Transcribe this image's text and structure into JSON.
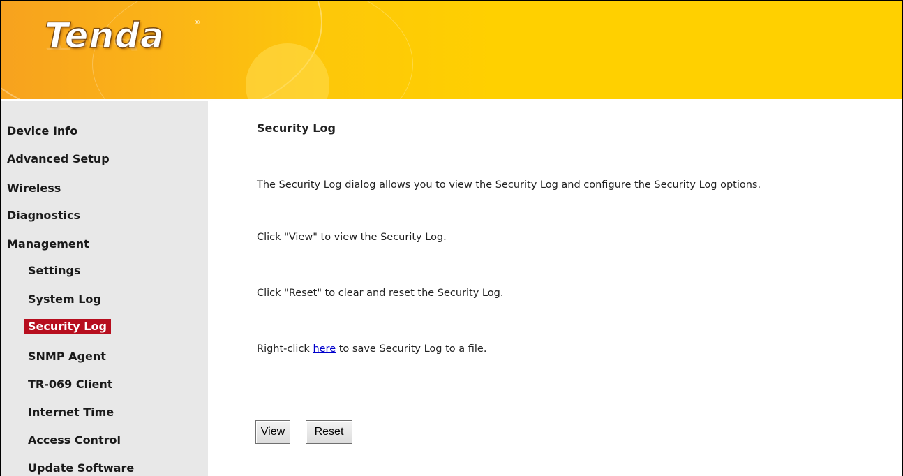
{
  "brand": {
    "logo_text": "Tenda",
    "trademark": "®"
  },
  "sidebar": {
    "items": [
      {
        "label": "Device Info"
      },
      {
        "label": "Advanced Setup"
      },
      {
        "label": "Wireless"
      },
      {
        "label": "Diagnostics"
      },
      {
        "label": "Management"
      },
      {
        "label": "Settings"
      },
      {
        "label": "System Log"
      },
      {
        "label": "Security Log"
      },
      {
        "label": "SNMP Agent"
      },
      {
        "label": "TR-069 Client"
      },
      {
        "label": "Internet Time"
      },
      {
        "label": "Access Control"
      },
      {
        "label": "Update Software"
      }
    ],
    "active_item": "Security Log"
  },
  "main": {
    "title": "Security Log",
    "description": "The Security Log dialog allows you to view the Security Log and configure the Security Log options.",
    "view_hint": "Click \"View\" to view the Security Log.",
    "reset_hint": "Click \"Reset\" to clear and reset the Security Log.",
    "save_hint_prefix": "Right-click ",
    "save_hint_link": "here",
    "save_hint_suffix": " to save Security Log to a file.",
    "view_button": "View",
    "reset_button": "Reset"
  },
  "colors": {
    "header_yellow": "#ffd000",
    "sidebar_bg": "#e8e8e8",
    "active_item_bg": "#b70e1e",
    "link": "#0000cc"
  }
}
